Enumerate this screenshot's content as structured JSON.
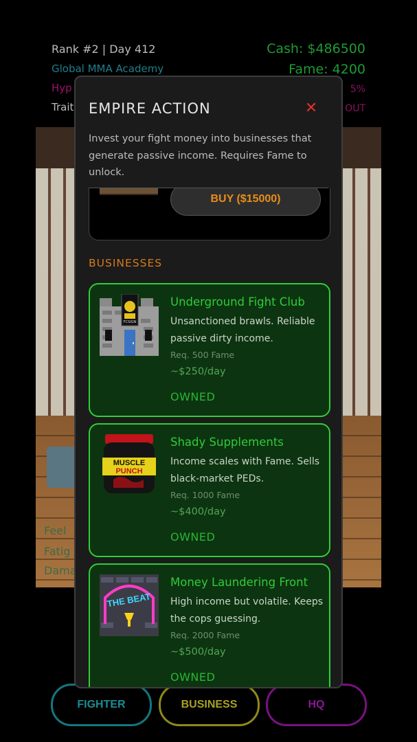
{
  "hud": {
    "rank_day": "Rank #2 | Day 412",
    "academy": "Global MMA Academy",
    "hype_partial": "Hyp",
    "traits_partial": "Trait",
    "cash": "Cash: $486500",
    "fame": "Fame: 4200",
    "right_small_1": "5%",
    "right_small_2": "OUT"
  },
  "dojo": {
    "stat_fatigue_partial": "Fatig",
    "stat_damage_partial": "Dama",
    "stat_top_partial": "Feel"
  },
  "modal": {
    "title": "EMPIRE ACTION",
    "close_glyph": "✕",
    "description": "Invest your fight money into businesses that generate passive income. Requires Fame to unlock.",
    "buy_label": "BUY ($15000)",
    "section_label": "BUSINESSES",
    "businesses": [
      {
        "name": "Underground Fight Club",
        "description": "Unsanctioned brawls. Reliable passive dirty income.",
        "requirement": "Req. 500 Fame",
        "income": "~$250/day",
        "status": "OWNED",
        "sign_text": "FCSIGN"
      },
      {
        "name": "Shady Supplements",
        "description": "Income scales with Fame. Sells black-market PEDs.",
        "requirement": "Req. 1000 Fame",
        "income": "~$400/day",
        "status": "OWNED",
        "label_line1": "MUSCLE",
        "label_line2": "PUNCH"
      },
      {
        "name": "Money Laundering Front",
        "description": "High income but volatile. Keeps the cops guessing.",
        "requirement": "Req. 2000 Fame",
        "income": "~$500/day",
        "status": "OWNED",
        "neon_text": "THE BEAT"
      }
    ]
  },
  "nav": {
    "fighter": "FIGHTER",
    "business": "BUSINESS",
    "hq": "HQ"
  }
}
